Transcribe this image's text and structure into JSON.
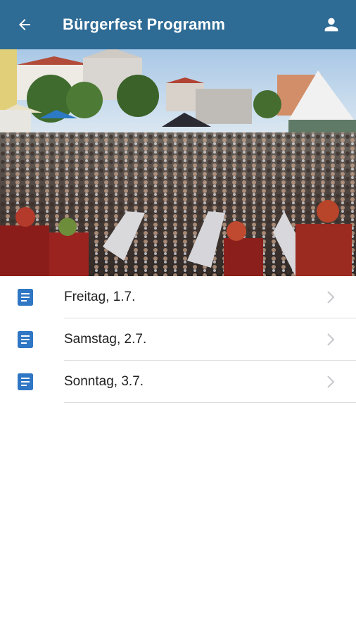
{
  "app": {
    "title": "Bürgerfest Programm",
    "accent": "#2e6b95"
  },
  "header": {
    "back_icon": "arrow-left-icon",
    "profile_icon": "person-icon"
  },
  "hero": {
    "image": "festival-crowd-photo"
  },
  "days": [
    {
      "label": "Freitag, 1.7.",
      "icon": "document-icon"
    },
    {
      "label": "Samstag, 2.7.",
      "icon": "document-icon"
    },
    {
      "label": "Sonntag, 3.7.",
      "icon": "document-icon"
    }
  ]
}
